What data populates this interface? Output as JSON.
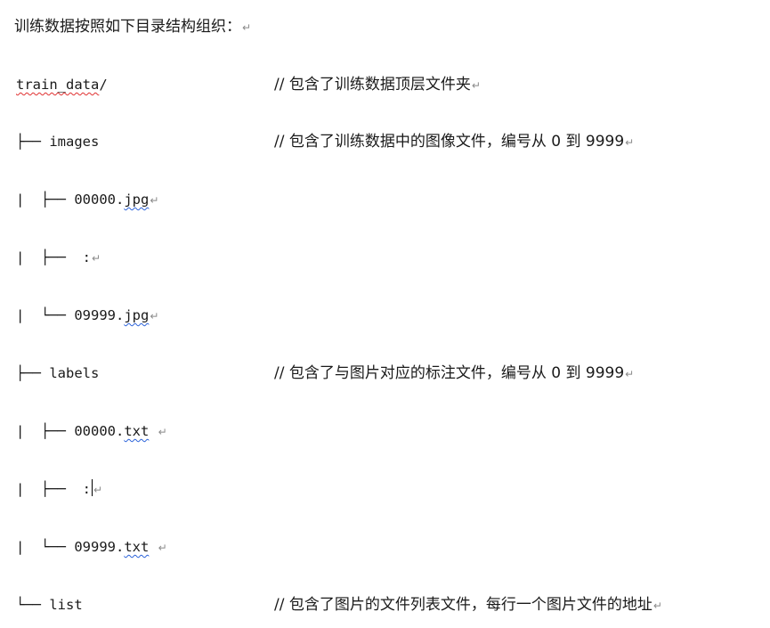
{
  "intro": "训练数据按照如下目录结构组织：",
  "paragraph_mark": "↵",
  "rows": [
    {
      "pre": "",
      "name": "train_data",
      "post": "/",
      "comment": "// 包含了训练数据顶层文件夹"
    },
    {
      "pre": "├── ",
      "name": "images",
      "post": "",
      "comment": "// 包含了训练数据中的图像文件，编号从 0 到 9999"
    },
    {
      "pre": "|  ├── 00000.",
      "name": "jpg",
      "post": ""
    },
    {
      "pre": "|  ├──  :",
      "name": "",
      "post": ""
    },
    {
      "pre": "|  └── 09999.",
      "name": "jpg",
      "post": ""
    },
    {
      "pre": "├── ",
      "name": "labels",
      "post": "",
      "comment": "// 包含了与图片对应的标注文件，编号从 0 到 9999"
    },
    {
      "pre": "|  ├── 00000.",
      "name": "txt",
      "post": " "
    },
    {
      "pre": "|  ├──  :",
      "name": "",
      "post": ""
    },
    {
      "pre": "|  └── 09999.",
      "name": "txt",
      "post": " "
    },
    {
      "pre": "└── ",
      "name": "list",
      "post": "",
      "comment": "// 包含了图片的文件列表文件，每行一个图片文件的地址"
    }
  ]
}
